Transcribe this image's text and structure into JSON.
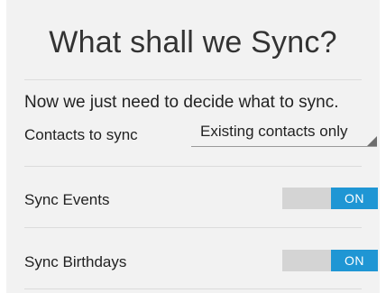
{
  "title": "What shall we Sync?",
  "intro": "Now we just need to decide what to sync.",
  "contacts": {
    "label": "Contacts to sync",
    "selected": "Existing contacts only"
  },
  "events": {
    "label": "Sync Events",
    "state": "ON"
  },
  "birthdays": {
    "label": "Sync Birthdays",
    "state": "ON"
  },
  "colors": {
    "accent": "#1f96d4",
    "track": "#d4d4d4"
  }
}
